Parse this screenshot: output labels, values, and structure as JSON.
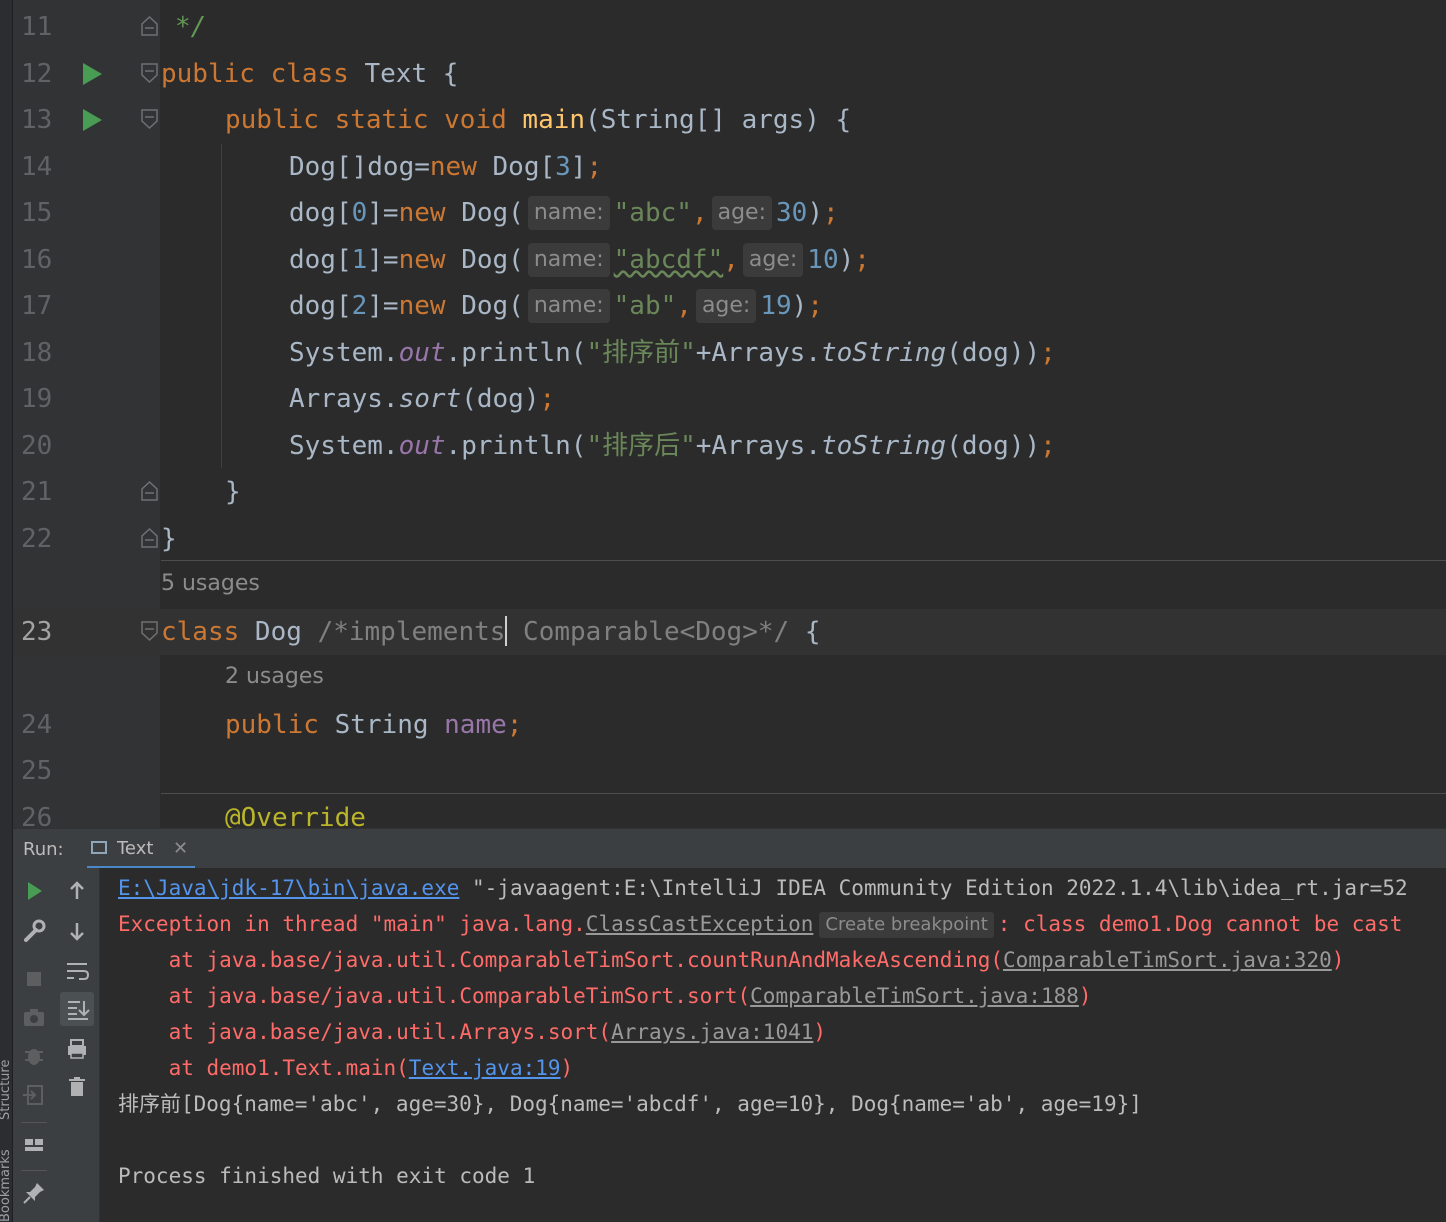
{
  "editor": {
    "lines": [
      {
        "n": "11",
        "t1": "*/"
      },
      {
        "n": "12",
        "kw1": "public class ",
        "name": "Text",
        "rest": " {"
      },
      {
        "n": "13",
        "kw": "public static void ",
        "fn": "main",
        "rest": "(String[] args) {"
      },
      {
        "n": "14",
        "a": "Dog[]dog=",
        "kw": "new",
        "b": " Dog[",
        "num": "3",
        "c": "]",
        "semi": ";"
      },
      {
        "n": "15",
        "a": "dog[",
        "idx": "0",
        "b": "]=",
        "kw": "new",
        "c": " Dog(",
        "h1": "name:",
        "s": "\"abc\"",
        "comma": ",",
        "h2": "age:",
        "num": "30",
        "d": ")",
        "semi": ";"
      },
      {
        "n": "16",
        "a": "dog[",
        "idx": "1",
        "b": "]=",
        "kw": "new",
        "c": " Dog(",
        "h1": "name:",
        "s": "\"abcdf\"",
        "comma": ",",
        "h2": "age:",
        "num": "10",
        "d": ")",
        "semi": ";"
      },
      {
        "n": "17",
        "a": "dog[",
        "idx": "2",
        "b": "]=",
        "kw": "new",
        "c": " Dog(",
        "h1": "name:",
        "s": "\"ab\"",
        "comma": ",",
        "h2": "age:",
        "num": "19",
        "d": ")",
        "semi": ";"
      },
      {
        "n": "18",
        "a": "System.",
        "st": "out",
        "b": ".println(",
        "s": "\"排序前\"",
        "c": "+Arrays.",
        "it": "toString",
        "d": "(dog))",
        "semi": ";"
      },
      {
        "n": "19",
        "a": "Arrays.",
        "it": "sort",
        "b": "(dog)",
        "semi": ";"
      },
      {
        "n": "20",
        "a": "System.",
        "st": "out",
        "b": ".println(",
        "s": "\"排序后\"",
        "c": "+Arrays.",
        "it": "toString",
        "d": "(dog))",
        "semi": ";"
      },
      {
        "n": "21",
        "t": "}"
      },
      {
        "n": "22",
        "t": "}"
      },
      {
        "n": "23",
        "kw": "class",
        "b": " Dog ",
        "cm1": "/*implements",
        "cm2": " Comparable<Dog>*/",
        "d": " {"
      },
      {
        "n": "24",
        "kw": "public",
        "b": " String ",
        "fld": "name",
        "semi": ";"
      },
      {
        "n": "25"
      },
      {
        "n": "26",
        "ann": "@Override"
      }
    ],
    "usages_5": "5 usages",
    "usages_2": "2 usages"
  },
  "run_panel": {
    "label": "Run:",
    "tab": "Text",
    "console": {
      "l1_link": "E:\\Java\\jdk-17\\bin\\java.exe",
      "l1_rest": " \"-javaagent:E:\\IntelliJ IDEA Community Edition 2022.1.4\\lib\\idea_rt.jar=52",
      "l2_a": "Exception in thread \"main\" java.lang.",
      "l2_link": "ClassCastException",
      "l2_hint": "Create breakpoint",
      "l2_b": ": class demo1.Dog cannot be cast",
      "l3_a": "    at java.base/java.util.ComparableTimSort.countRunAndMakeAscending(",
      "l3_link": "ComparableTimSort.java:320",
      "l3_b": ")",
      "l4_a": "    at java.base/java.util.ComparableTimSort.sort(",
      "l4_link": "ComparableTimSort.java:188",
      "l4_b": ")",
      "l5_a": "    at java.base/java.util.Arrays.sort(",
      "l5_link": "Arrays.java:1041",
      "l5_b": ")",
      "l6_a": "    at demo1.Text.main(",
      "l6_link": "Text.java:19",
      "l6_b": ")",
      "l7": "排序前[Dog{name='abc', age=30}, Dog{name='abcdf', age=10}, Dog{name='ab', age=19}]",
      "l9": "Process finished with exit code 1"
    }
  },
  "side_labels": {
    "structure": "Structure",
    "bookmarks": "Bookmarks"
  },
  "colors": {
    "keyword": "#cc7832",
    "string": "#6a8759",
    "number": "#6897bb",
    "error": "#ff6b68",
    "link": "#5394ec"
  }
}
